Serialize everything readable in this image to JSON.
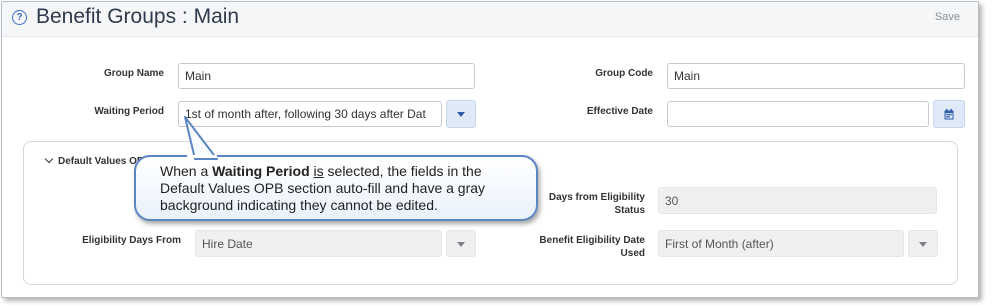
{
  "header": {
    "help_icon": "help-circle-icon",
    "title": "Benefit Groups : Main",
    "save_label": "Save"
  },
  "form": {
    "group_name_label": "Group Name",
    "group_name_value": "Main",
    "group_code_label": "Group Code",
    "group_code_value": "Main",
    "waiting_period_label": "Waiting Period",
    "waiting_period_value": "1st of month after, following 30 days after Dat",
    "effective_date_label": "Effective Date",
    "effective_date_value": "",
    "calendar_icon": "calendar-icon"
  },
  "section": {
    "title": "Default Values OBP",
    "days_label": "Days from Eligibility Status",
    "days_value": "30",
    "eligibility_from_label": "Eligibility Days From",
    "eligibility_from_value": "Hire Date",
    "benefit_date_label": "Benefit Eligibility Date Used",
    "benefit_date_value": "First of Month (after)"
  },
  "callout": {
    "part1": "When a ",
    "bold": "Waiting Period",
    "part2": " ",
    "underlined": "is",
    "part3": " selected, the fields in the Default Values OPB section auto-fill and have a gray background indicating they cannot be edited."
  },
  "colors": {
    "accent": "#3a6fc4",
    "callout_border": "#5a86c2",
    "readonly_bg": "#f0f0f0"
  }
}
